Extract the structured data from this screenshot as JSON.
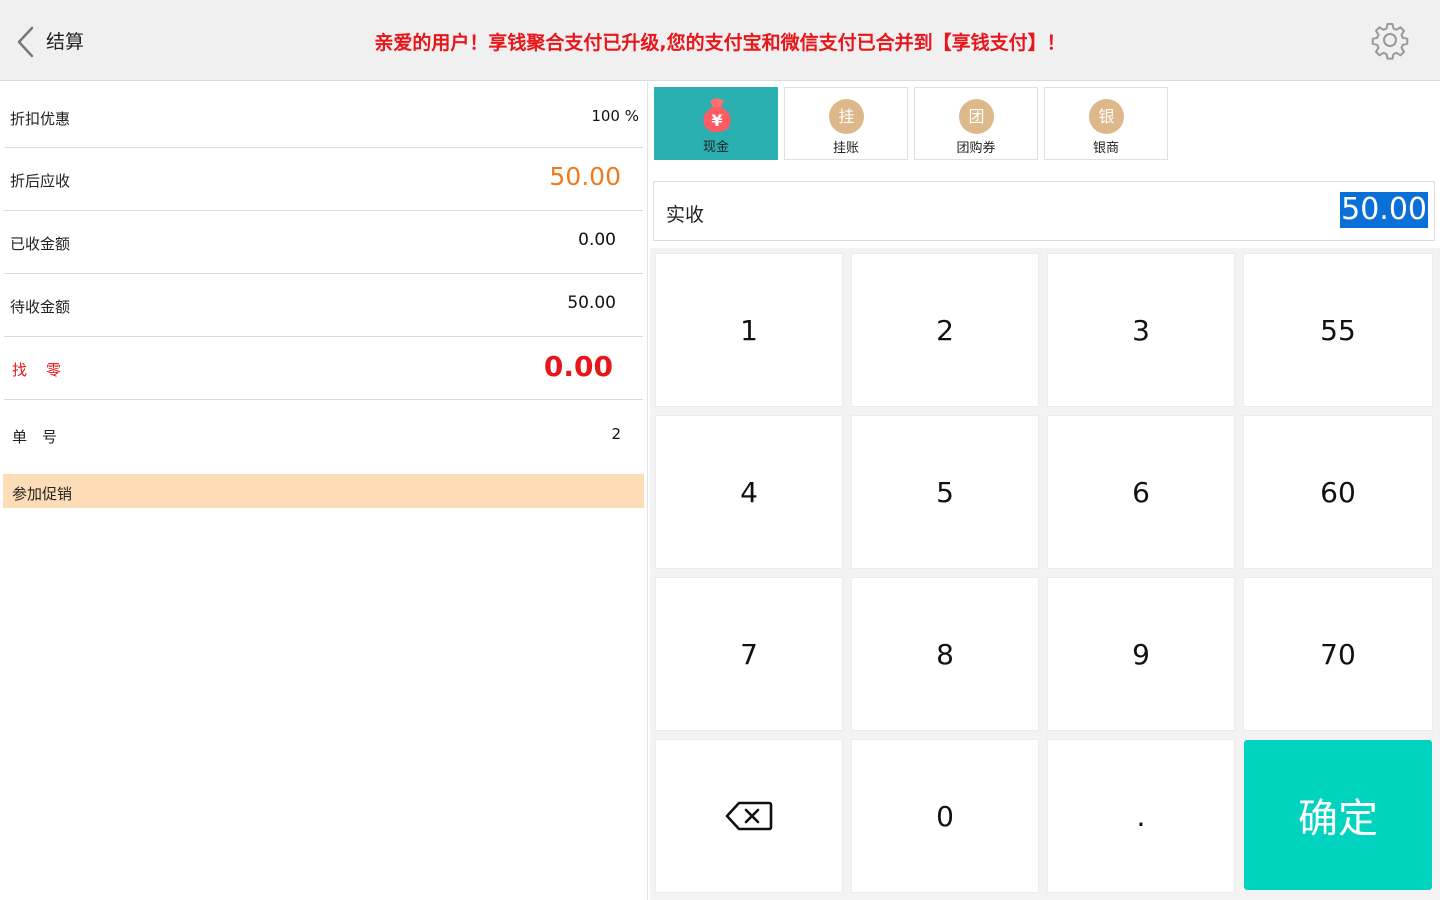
{
  "header": {
    "title": "结算",
    "notice": "亲爱的用户！享钱聚合支付已升级,您的支付宝和微信支付已合并到【享钱支付】！"
  },
  "summary": {
    "discount_label": "折扣优惠",
    "discount_value": "100 %",
    "receivable_label": "折后应收",
    "receivable_value": "50.00",
    "received_label": "已收金额",
    "received_value": "0.00",
    "pending_label": "待收金额",
    "pending_value": "50.00",
    "change_label": "找　零",
    "change_value": "0.00",
    "order_no_label": "单　号",
    "order_no_value": "2",
    "promotion_label": "参加促销"
  },
  "payment_methods": [
    {
      "label": "现金",
      "icon": "money-bag-icon",
      "icon_text": "¥",
      "active": true
    },
    {
      "label": "挂账",
      "icon": "credit-icon",
      "icon_text": "挂",
      "active": false
    },
    {
      "label": "团购券",
      "icon": "group-buy-icon",
      "icon_text": "团",
      "active": false
    },
    {
      "label": "银商",
      "icon": "bank-icon",
      "icon_text": "银",
      "active": false
    }
  ],
  "amount_input": {
    "label": "实收",
    "value": "50.00"
  },
  "keypad": {
    "keys": [
      "1",
      "2",
      "3",
      "55",
      "4",
      "5",
      "6",
      "60",
      "7",
      "8",
      "9",
      "70",
      "",
      "0",
      ".",
      "确定"
    ],
    "backspace_icon": "backspace-icon",
    "confirm_label": "确定"
  },
  "colors": {
    "accent_teal": "#2ab0b1",
    "confirm_teal": "#00d4be",
    "notice_red": "#e8161b",
    "receivable_orange": "#f07a1f",
    "promo_bg": "#fddcb8",
    "selection_blue": "#0a6fd6"
  }
}
